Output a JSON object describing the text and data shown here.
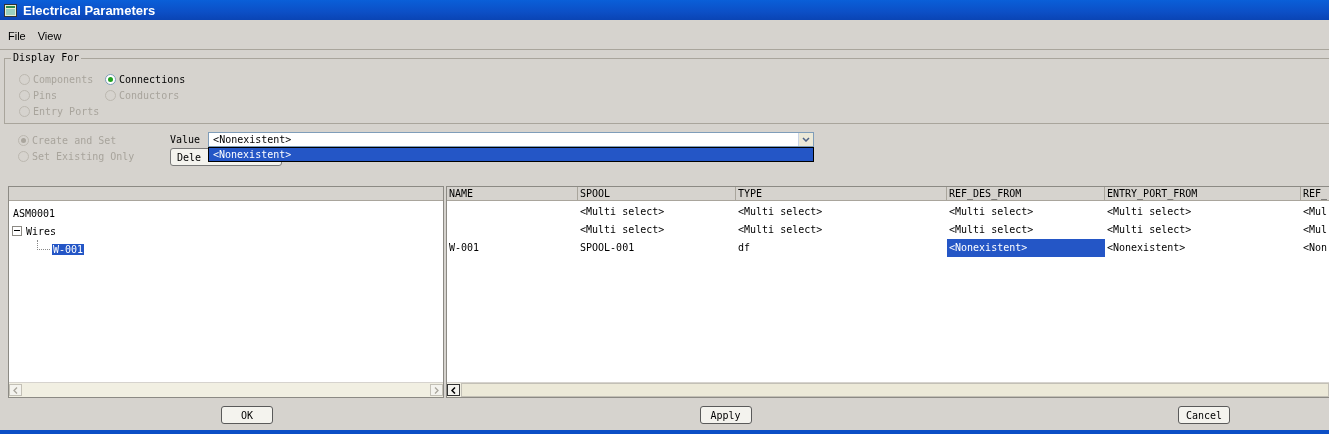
{
  "window": {
    "title": "Electrical Parameters"
  },
  "menu": [
    {
      "label": "File"
    },
    {
      "label": "View"
    }
  ],
  "display_for": {
    "label": "Display For",
    "options": [
      {
        "label": "Components",
        "selected": false,
        "disabled": true
      },
      {
        "label": "Connections",
        "selected": true,
        "disabled": false
      },
      {
        "label": "Pins",
        "selected": false,
        "disabled": true
      },
      {
        "label": "Conductors",
        "selected": false,
        "disabled": true
      },
      {
        "label": "Entry Ports",
        "selected": false,
        "disabled": true
      }
    ]
  },
  "mode": [
    {
      "label": "Create and Set",
      "selected": true,
      "disabled": true
    },
    {
      "label": "Set Existing Only",
      "selected": false,
      "disabled": true
    }
  ],
  "value": {
    "label": "Value",
    "value": "<Nonexistent>",
    "expanded": true,
    "options": [
      {
        "label": "<Nonexistent>",
        "selected": true
      }
    ]
  },
  "delete_button": "Dele",
  "tree": [
    {
      "label": "ASM0001",
      "selected": false,
      "children": [
        {
          "label": "Wires",
          "selected": false,
          "expanded": true,
          "children": [
            {
              "label": "W-001",
              "selected": true
            }
          ]
        }
      ]
    }
  ],
  "table": {
    "columns": [
      "NAME",
      "SPOOL",
      "TYPE",
      "REF_DES_FROM",
      "ENTRY_PORT_FROM",
      "REF_"
    ],
    "rows": [
      {
        "cells": [
          {
            "text": "",
            "selected": false
          },
          {
            "text": "<Multi select>",
            "selected": false
          },
          {
            "text": "<Multi select>",
            "selected": false
          },
          {
            "text": "<Multi select>",
            "selected": false
          },
          {
            "text": "<Multi select>",
            "selected": false
          },
          {
            "text": "<Mul",
            "selected": false
          }
        ]
      },
      {
        "cells": [
          {
            "text": "",
            "selected": false
          },
          {
            "text": "<Multi select>",
            "selected": false
          },
          {
            "text": "<Multi select>",
            "selected": false
          },
          {
            "text": "<Multi select>",
            "selected": false
          },
          {
            "text": "<Multi select>",
            "selected": false
          },
          {
            "text": "<Mul",
            "selected": false
          }
        ]
      },
      {
        "cells": [
          {
            "text": "W-001",
            "selected": false
          },
          {
            "text": "SPOOL-001",
            "selected": false
          },
          {
            "text": "df",
            "selected": false
          },
          {
            "text": "<Nonexistent>",
            "selected": true
          },
          {
            "text": "<Nonexistent>",
            "selected": false
          },
          {
            "text": "<Non",
            "selected": false
          }
        ]
      }
    ]
  },
  "buttons": [
    {
      "label": "OK"
    },
    {
      "label": "Apply"
    },
    {
      "label": "Cancel"
    }
  ]
}
